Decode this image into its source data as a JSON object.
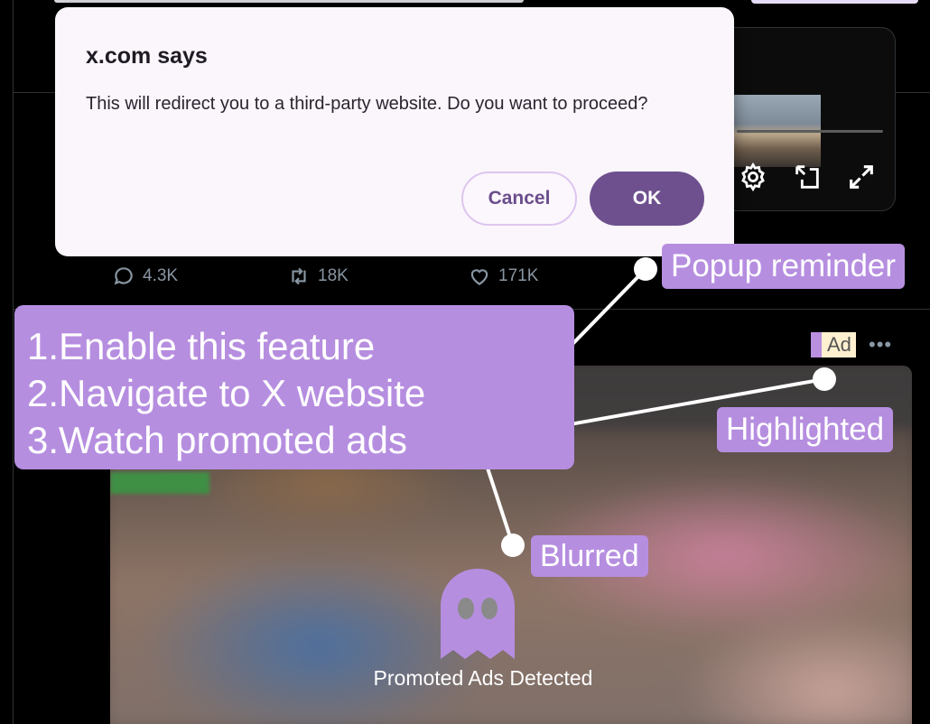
{
  "dialog": {
    "title": "x.com says",
    "message": "This will redirect you to a third-party website. Do you want to proceed?",
    "cancel_label": "Cancel",
    "ok_label": "OK"
  },
  "tweet1": {
    "actions": {
      "replies": "4.3K",
      "reposts": "18K",
      "likes": "171K"
    }
  },
  "tweet2": {
    "ad_badge": "Ad",
    "more": "•••",
    "overlay_label": "Promoted Ads Detected"
  },
  "annotations": {
    "steps": [
      "1.Enable this feature",
      "2.Navigate to X website",
      "3.Watch promoted ads"
    ],
    "popup": "Popup reminder",
    "highlighted": "Highlighted",
    "blurred": "Blurred"
  },
  "colors": {
    "accent": "#b68ee0",
    "ok_button": "#6e508f",
    "ad_badge_bg": "#fff0d0"
  },
  "icons": [
    "reply-icon",
    "repost-icon",
    "like-icon",
    "settings-icon",
    "pip-icon",
    "fullscreen-icon",
    "ghost-icon"
  ]
}
